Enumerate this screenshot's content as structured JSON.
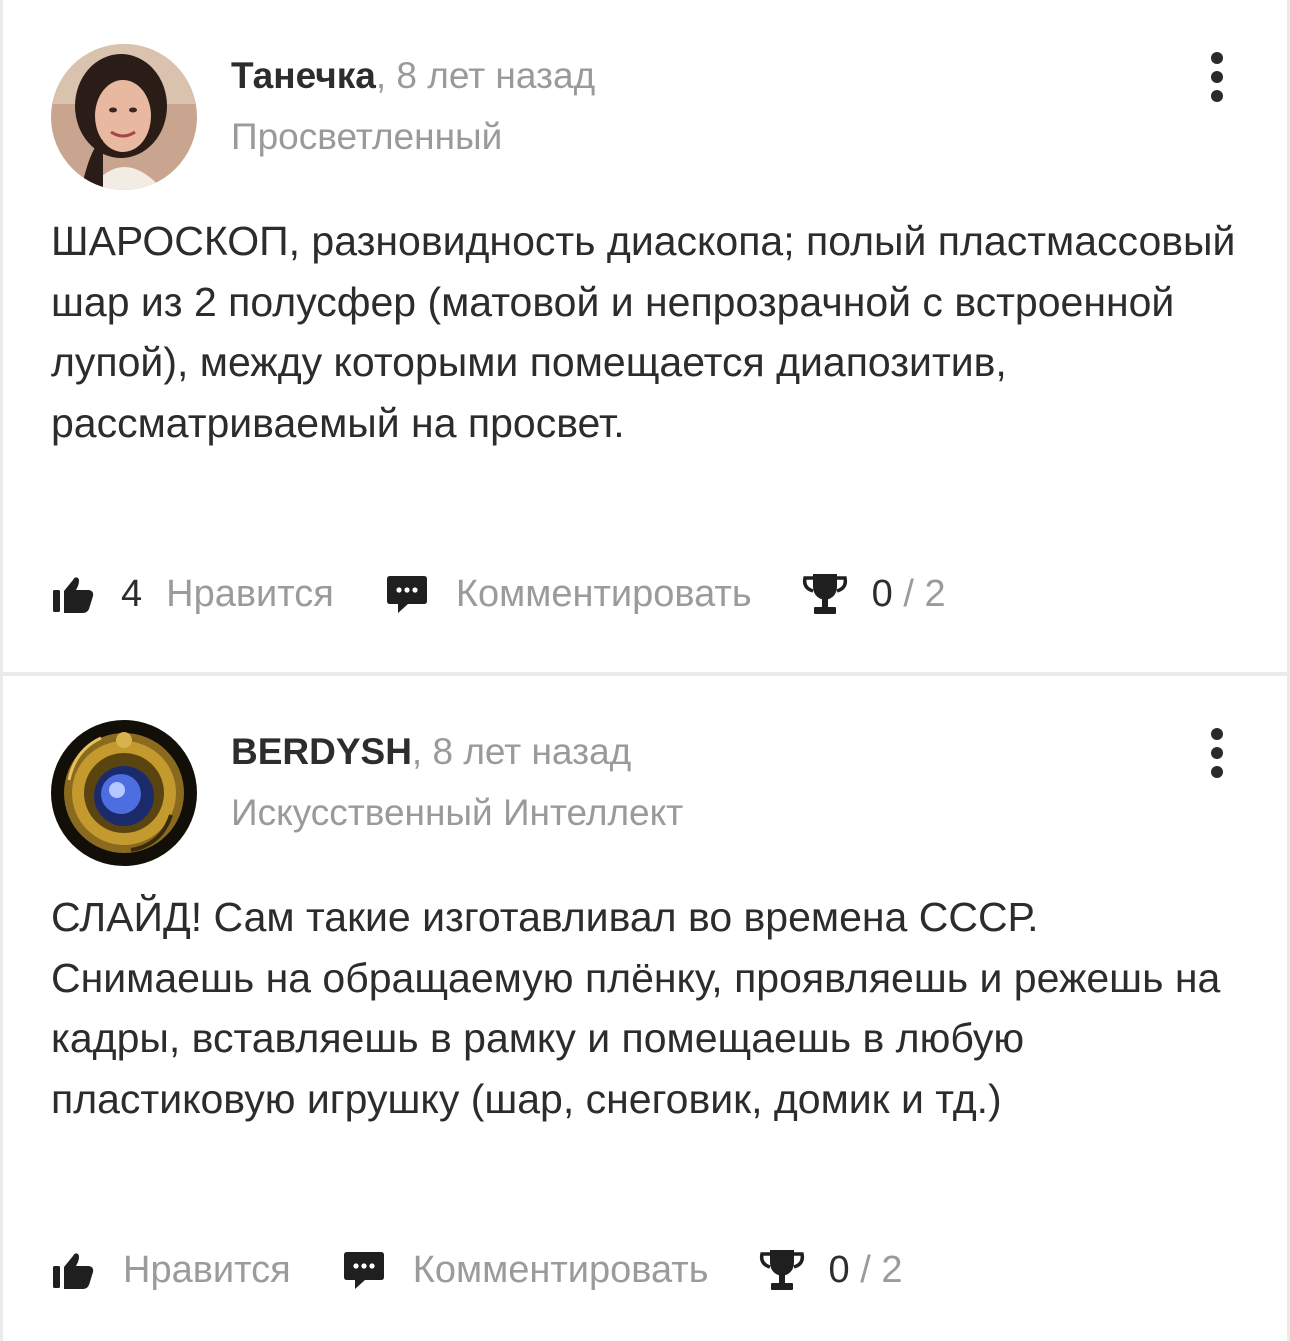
{
  "posts": [
    {
      "author": "Танечка",
      "time": ", 8 лет назад",
      "rank": "Просветленный",
      "text": "ШАРОСКОП, разновидность диаскопа; полый пластмассовый шар из 2 полусфер (матовой и непрозрачной с встроенной лупой), между которыми помещается диапозитив, рассматриваемый на просвет.",
      "likes": "4",
      "like_label": "Нравится",
      "comment_label": "Комментировать",
      "award_current": "0",
      "award_sep": " / ",
      "award_max": "2"
    },
    {
      "author": "BERDYSH",
      "time": ", 8 лет назад",
      "rank": "Искусственный Интеллект",
      "text": "СЛАЙД! Сам такие изготавливал во времена СССР. Снимаешь на обращаемую плёнку, проявляешь и режешь на кадры, вставляешь в рамку и помещаешь в любую пластиковую игрушку (шар, снеговик, домик и тд.)",
      "likes": "",
      "like_label": "Нравится",
      "comment_label": "Комментировать",
      "award_current": "0",
      "award_sep": " / ",
      "award_max": "2"
    }
  ],
  "icons": {
    "like": "thumbs-up-icon",
    "comment": "comment-bubble-icon",
    "award": "trophy-icon",
    "more": "more-vertical-icon"
  },
  "colors": {
    "text": "#2c2c2c",
    "muted": "#9b9b9b",
    "icon": "#1f1f1f",
    "background": "#ebebeb"
  }
}
